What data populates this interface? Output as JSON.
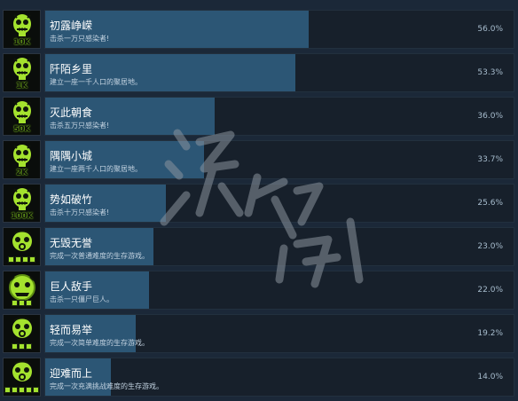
{
  "achievements": [
    {
      "icon": "zombie-head-icon",
      "badge": "10K",
      "pips": 0,
      "title": "初露峥嵘",
      "desc": "击杀一万只感染者!",
      "percent_label": "56.0%",
      "percent": 56.0
    },
    {
      "icon": "zombie-head-icon",
      "badge": "1K",
      "pips": 0,
      "title": "阡陌乡里",
      "desc": "建立一座一千人口的聚居地。",
      "percent_label": "53.3%",
      "percent": 53.3
    },
    {
      "icon": "zombie-head-icon",
      "badge": "50K",
      "pips": 0,
      "title": "灭此朝食",
      "desc": "击杀五万只感染者!",
      "percent_label": "36.0%",
      "percent": 36.0
    },
    {
      "icon": "zombie-head-icon",
      "badge": "2K",
      "pips": 0,
      "title": "隅隅小城",
      "desc": "建立一座两千人口的聚居地。",
      "percent_label": "33.7%",
      "percent": 33.7
    },
    {
      "icon": "zombie-head-icon",
      "badge": "100K",
      "pips": 0,
      "title": "势如破竹",
      "desc": "击杀十万只感染者!",
      "percent_label": "25.6%",
      "percent": 25.6
    },
    {
      "icon": "gasmask-icon",
      "badge": "",
      "pips": 4,
      "title": "无毁无誉",
      "desc": "完成一次普通难度的生存游戏。",
      "percent_label": "23.0%",
      "percent": 23.0
    },
    {
      "icon": "giant-zombie-icon",
      "badge": "",
      "pips": 3,
      "title": "巨人敌手",
      "desc": "击杀一只僵尸巨人。",
      "percent_label": "22.0%",
      "percent": 22.0
    },
    {
      "icon": "gasmask-icon",
      "badge": "",
      "pips": 3,
      "title": "轻而易举",
      "desc": "完成一次简单难度的生存游戏。",
      "percent_label": "19.2%",
      "percent": 19.2
    },
    {
      "icon": "gasmask-icon",
      "badge": "",
      "pips": 5,
      "title": "迎难而上",
      "desc": "完成一次充满挑战难度的生存游戏。",
      "percent_label": "14.0%",
      "percent": 14.0
    }
  ],
  "colors": {
    "accent": "#a4e22e",
    "bar_fill": "#2c5675",
    "panel": "#17202b",
    "background": "#1b2838"
  }
}
